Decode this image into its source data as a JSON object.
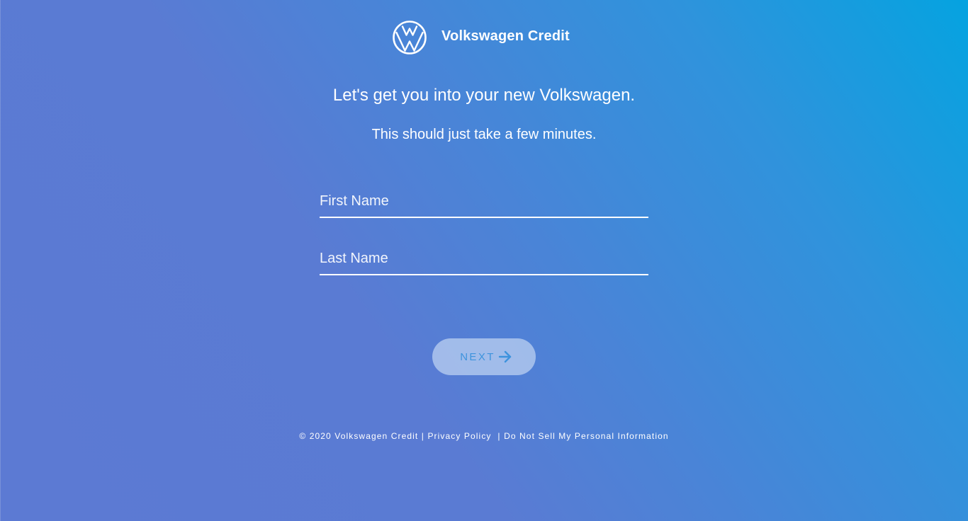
{
  "header": {
    "brand_name": "Volkswagen Credit",
    "logo_icon": "vw-logo-icon"
  },
  "main": {
    "headline": "Let's get you into your new Volkswagen.",
    "subline": "This should just take a few minutes.",
    "fields": {
      "first_name": {
        "value": "",
        "placeholder": "First Name"
      },
      "last_name": {
        "value": "",
        "placeholder": "Last Name"
      }
    },
    "next_button": {
      "label": "NEXT",
      "icon": "arrow-right-icon"
    }
  },
  "footer": {
    "copyright": "© 2020 Volkswagen Credit",
    "separator_1": " | ",
    "privacy_link": "Privacy Policy",
    "separator_2": "  | ",
    "do_not_sell_link": "Do Not Sell My Personal Information"
  },
  "colors": {
    "gradient_top_right": "#05a3e0",
    "gradient_bottom_left": "#5c7ad3",
    "button_background": "#b7cdf0",
    "button_text": "#3e93dd",
    "text": "#ffffff"
  }
}
